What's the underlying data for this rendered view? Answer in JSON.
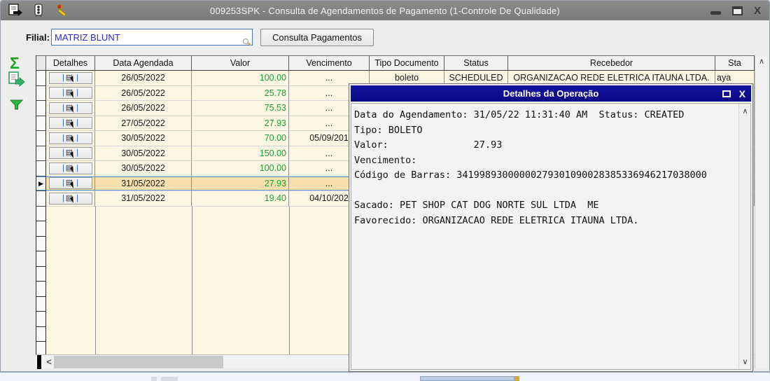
{
  "window": {
    "title": "009253SPK - Consulta de Agendamentos de Pagamento (1-Controle De Qualidade)"
  },
  "toolbar": {
    "filial_label": "Filial:",
    "filial_value": "MATRIZ BLUNT",
    "consulta_button_label": "Consulta Pagamentos"
  },
  "icons": {
    "sigma": "Σ",
    "pipe": "|",
    "grid_sheet": "▤",
    "row_marker": "▶",
    "scroll_up": "∧",
    "scroll_down": "∨",
    "scroll_left": "<",
    "close_x": "X",
    "popup_close_x": "X"
  },
  "grid": {
    "headers": [
      "Detalhes",
      "Data Agendada",
      "Valor",
      "Vencimento",
      "Tipo Documento",
      "Status",
      "Recebedor",
      "Sta"
    ],
    "rows": [
      {
        "data_agendada": "26/05/2022",
        "valor": "100.00",
        "vencimento": "...",
        "tipo_documento": "boleto",
        "status": "SCHEDULED",
        "recebedor": "ORGANIZACAO REDE ELETRICA ITAUNA LTDA.",
        "sta": "aya"
      },
      {
        "data_agendada": "26/05/2022",
        "valor": "25.78",
        "vencimento": "..."
      },
      {
        "data_agendada": "26/05/2022",
        "valor": "75.53",
        "vencimento": "..."
      },
      {
        "data_agendada": "27/05/2022",
        "valor": "27.93",
        "vencimento": "..."
      },
      {
        "data_agendada": "30/05/2022",
        "valor": "70.00",
        "vencimento": "05/09/201"
      },
      {
        "data_agendada": "30/05/2022",
        "valor": "150.00",
        "vencimento": "..."
      },
      {
        "data_agendada": "30/05/2022",
        "valor": "100.00",
        "vencimento": "..."
      },
      {
        "data_agendada": "31/05/2022",
        "valor": "27.93",
        "vencimento": "...",
        "selected": true
      },
      {
        "data_agendada": "31/05/2022",
        "valor": "19.40",
        "vencimento": "04/10/202"
      }
    ],
    "selected_row_index": 7
  },
  "popup": {
    "title": "Detalhes da Operação",
    "lines": [
      "Data do Agendamento: 31/05/22 11:31:40 AM  Status: CREATED",
      "Tipo: BOLETO",
      "Valor:               27.93",
      "Vencimento:",
      "Código de Barras: 34199893000000279301090028385336946217038000",
      " ",
      "Sacado: PET SHOP CAT DOG NORTE SUL LTDA  ME",
      "Favorecido: ORGANIZACAO REDE ELETRICA ITAUNA LTDA."
    ]
  },
  "colors": {
    "titlebar_gray": "#7E7E7E",
    "popup_titlebar_navy": "#0A0A86",
    "cell_cream": "#FBF6E1",
    "selected_row": "#F8E0AC",
    "value_green": "#17A237",
    "input_text_blue": "#2A2AD4"
  }
}
